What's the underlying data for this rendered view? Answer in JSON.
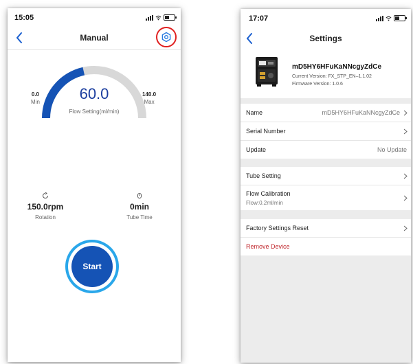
{
  "left": {
    "status": {
      "time": "15:05"
    },
    "nav": {
      "title": "Manual"
    },
    "gauge": {
      "value": "60.0",
      "label": "Flow Setting(ml/min)",
      "min_value": "0.0",
      "min_label": "Min",
      "max_value": "140.0",
      "max_label": "Max",
      "level": 0.43
    },
    "stats": {
      "rotation": {
        "value": "150.0rpm",
        "label": "Rotation"
      },
      "tube_time": {
        "value": "0min",
        "label": "Tube Time"
      }
    },
    "start_label": "Start"
  },
  "right": {
    "status": {
      "time": "17:07"
    },
    "nav": {
      "title": "Settings"
    },
    "device": {
      "name": "mD5HY6HFuKaNNcgyZdCe",
      "current_version": "Current Version:  FX_STP_EN–1.1.02",
      "firmware_version": "Firmware Version:  1.0.6"
    },
    "rows": {
      "name": {
        "label": "Name",
        "value": "mD5HY6HFuKaNNcgyZdCe"
      },
      "serial": {
        "label": "Serial Number"
      },
      "update": {
        "label": "Update",
        "value": "No Update"
      },
      "tube": {
        "label": "Tube Setting"
      },
      "flow": {
        "label": "Flow Calibration",
        "sub": "Flow:0.2ml/min"
      },
      "factory": {
        "label": "Factory Settings Reset"
      },
      "remove": {
        "label": "Remove Device"
      }
    }
  },
  "colors": {
    "accent_blue": "#1553b5",
    "ring_blue": "#2aa7ea",
    "highlight_red": "#e02020",
    "remove_red": "#c0262c"
  },
  "icons": [
    "back-chevron-icon",
    "gear-icon",
    "signal-icon",
    "wifi-icon",
    "battery-icon",
    "rotation-icon",
    "timer-icon",
    "chevron-right-icon",
    "device-icon"
  ]
}
